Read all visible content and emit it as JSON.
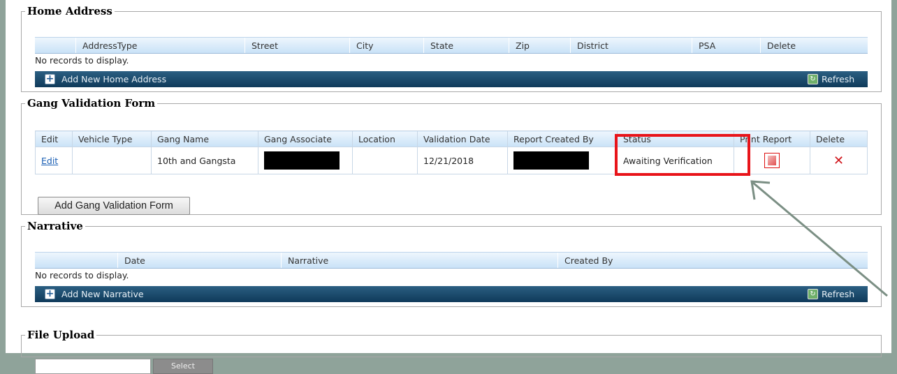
{
  "home_address": {
    "legend": "Home Address",
    "columns": [
      "AddressType",
      "Street",
      "City",
      "State",
      "Zip",
      "District",
      "PSA",
      "Delete"
    ],
    "empty_text": "No records to display.",
    "add_label": "Add New Home Address",
    "refresh_label": "Refresh"
  },
  "gang_validation": {
    "legend": "Gang Validation Form",
    "columns": [
      "Edit",
      "Vehicle Type",
      "Gang Name",
      "Gang Associate",
      "Location",
      "Validation Date",
      "Report Created By",
      "Status",
      "Print Report",
      "Delete"
    ],
    "row": {
      "edit": "Edit",
      "vehicle_type": "",
      "gang_name": "10th and Gangsta",
      "location": "",
      "validation_date": "12/21/2018",
      "status": "Awaiting Verification"
    },
    "add_button": "Add Gang Validation Form"
  },
  "narrative": {
    "legend": "Narrative",
    "columns": [
      "Date",
      "Narrative",
      "Created By"
    ],
    "empty_text": "No records to display.",
    "add_label": "Add New Narrative",
    "refresh_label": "Refresh"
  },
  "file_upload": {
    "legend": "File Upload",
    "select_label": "Select",
    "file_value": ""
  },
  "colors": {
    "highlight": "#e8141a",
    "command_bar": "#0f3a5a",
    "link": "#1a5fb4"
  },
  "icons": [
    "plus-icon",
    "refresh-icon",
    "pdf-icon",
    "delete-x-icon",
    "annotation-arrow"
  ]
}
